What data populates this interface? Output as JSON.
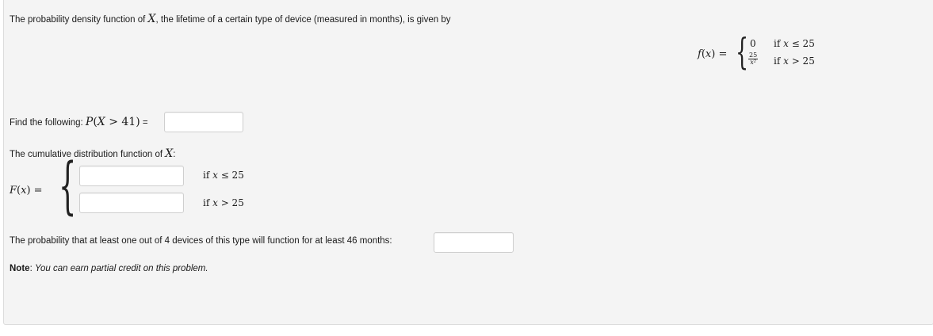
{
  "intro": {
    "text_before": "The probability density function of ",
    "variable": "X",
    "text_after": ", the lifetime of a certain type of device (measured in months), is given by"
  },
  "pdf": {
    "lhs_func": "f",
    "lhs_arg": "x",
    "case1_value": "0",
    "case1_cond": "if ",
    "case1_var": "x",
    "case1_rel": " ≤ 25",
    "case2_num": "25",
    "case2_den": "x²",
    "case2_cond": "if ",
    "case2_var": "x",
    "case2_rel": " > 25"
  },
  "question1": {
    "label": "Find the following: ",
    "expr_p": "P",
    "expr_var": "X",
    "expr_rest": " > 41)",
    "equals": " =",
    "answer_value": ""
  },
  "question2": {
    "label_before": "The cumulative distribution function of ",
    "label_var": "X",
    "label_after": ":",
    "lhs_func": "F",
    "lhs_arg": "x",
    "case1_answer": "",
    "case1_cond": "if ",
    "case1_var": "x",
    "case1_rel": " ≤ 25",
    "case2_answer": "",
    "case2_cond": "if ",
    "case2_var": "x",
    "case2_rel": " > 25"
  },
  "question3": {
    "label": "The probability that at least one out of 4 devices of this type will function for at least 46 months:",
    "answer_value": ""
  },
  "note": {
    "label": "Note",
    "text": "You can earn partial credit on this problem."
  }
}
